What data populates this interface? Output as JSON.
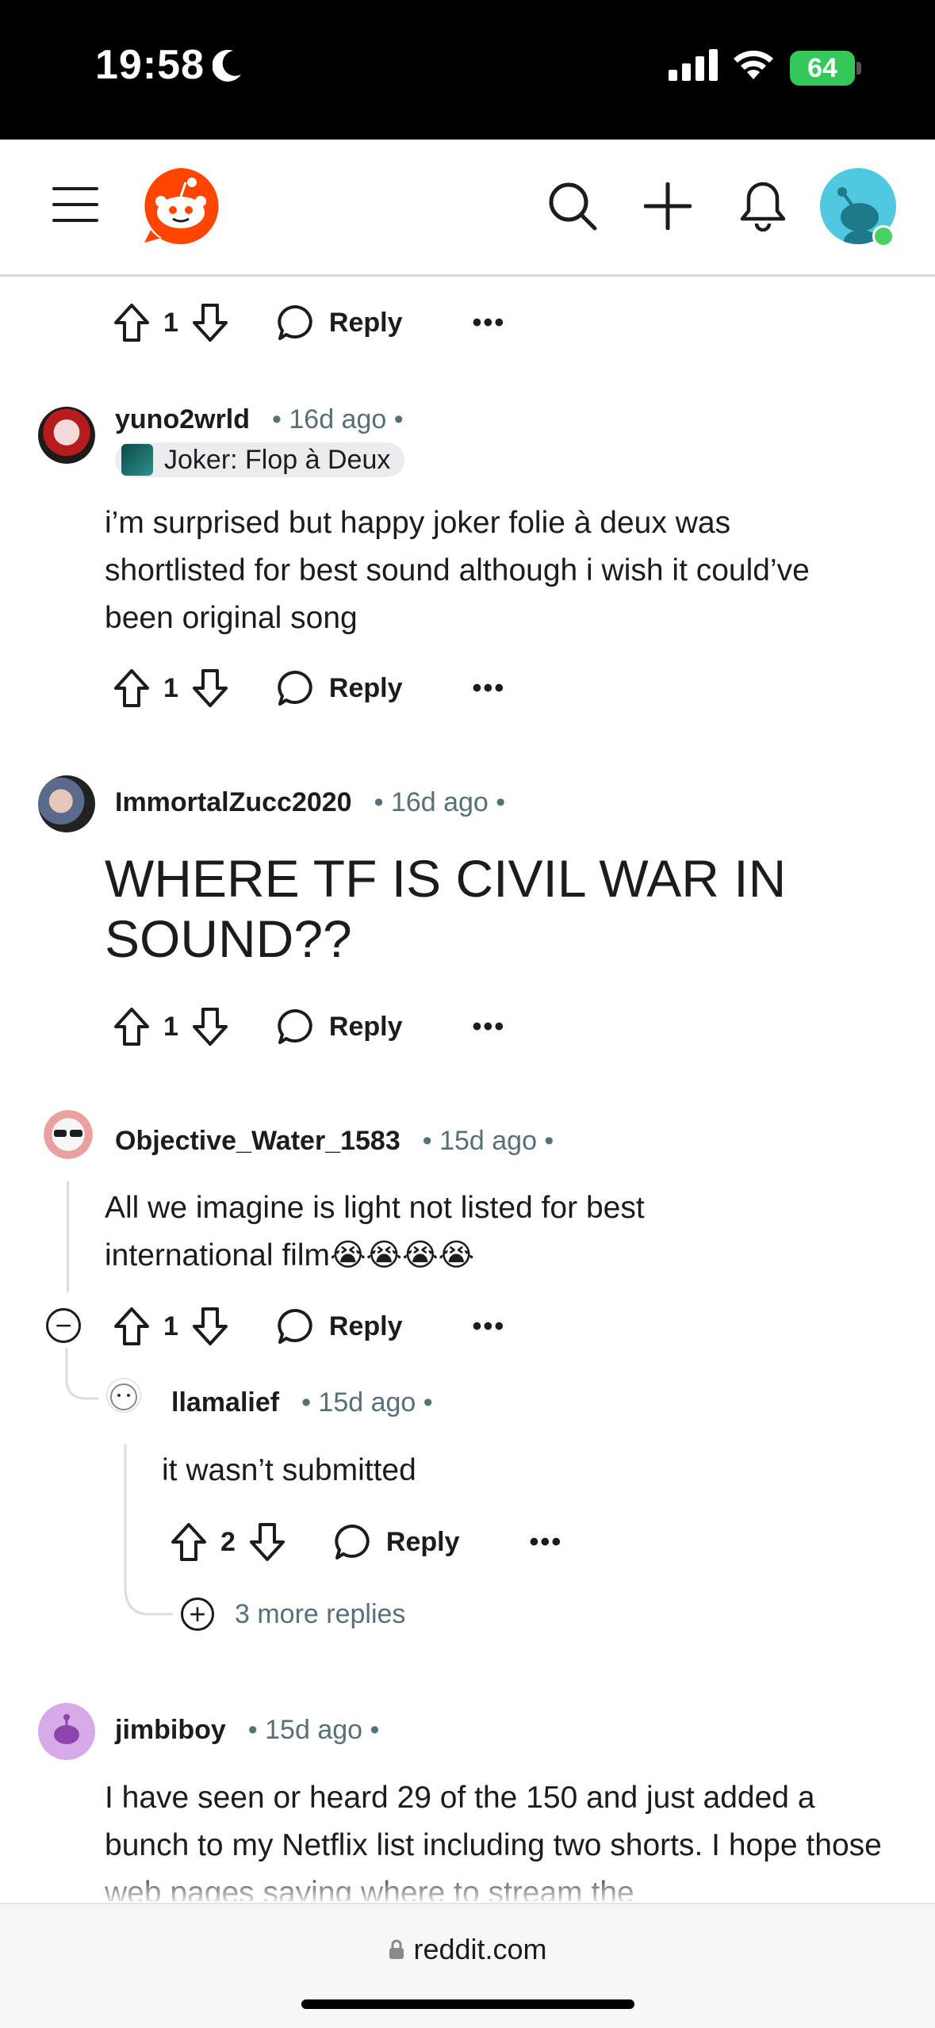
{
  "status": {
    "time": "19:58",
    "battery": "64"
  },
  "nav": {
    "menu_icon": "menu-icon",
    "logo_icon": "reddit-logo-icon",
    "search_icon": "search-icon",
    "create_icon": "plus-icon",
    "notifications_icon": "bell-icon",
    "profile_icon": "avatar"
  },
  "comments": [
    {
      "vote_count": "1",
      "reply_label": "Reply",
      "more_label": "•••"
    },
    {
      "username": "yuno2wrld",
      "time": "• 16d ago •",
      "flair": "Joker: Flop à Deux",
      "text": "i’m surprised but happy joker folie à deux was shortlisted for best sound although i wish it could’ve been original song",
      "vote_count": "1",
      "reply_label": "Reply",
      "more_label": "•••"
    },
    {
      "username": "ImmortalZucc2020",
      "time": "• 16d ago •",
      "text": "WHERE TF IS CIVIL WAR IN SOUND??",
      "vote_count": "1",
      "reply_label": "Reply",
      "more_label": "•••"
    },
    {
      "username": "Objective_Water_1583",
      "time": "• 15d ago •",
      "text": "All we imagine is light not listed for best international film😭😭😭😭",
      "vote_count": "1",
      "reply_label": "Reply",
      "more_label": "•••",
      "collapse_label": "−"
    },
    {
      "username": "llamalief",
      "time": "• 15d ago •",
      "text": "it wasn’t submitted",
      "vote_count": "2",
      "reply_label": "Reply",
      "more_label": "•••",
      "more_replies": "3 more replies"
    },
    {
      "username": "jimbiboy",
      "time": "• 15d ago •",
      "text": "I have seen or heard 29 of the 150 and just added a bunch to my Netflix list including two shorts. I hope those web pages saying where to stream the"
    }
  ],
  "browser": {
    "url": "reddit.com"
  },
  "colors": {
    "brand": "#ff4500",
    "meta": "#576f76",
    "battery": "#34c759"
  }
}
